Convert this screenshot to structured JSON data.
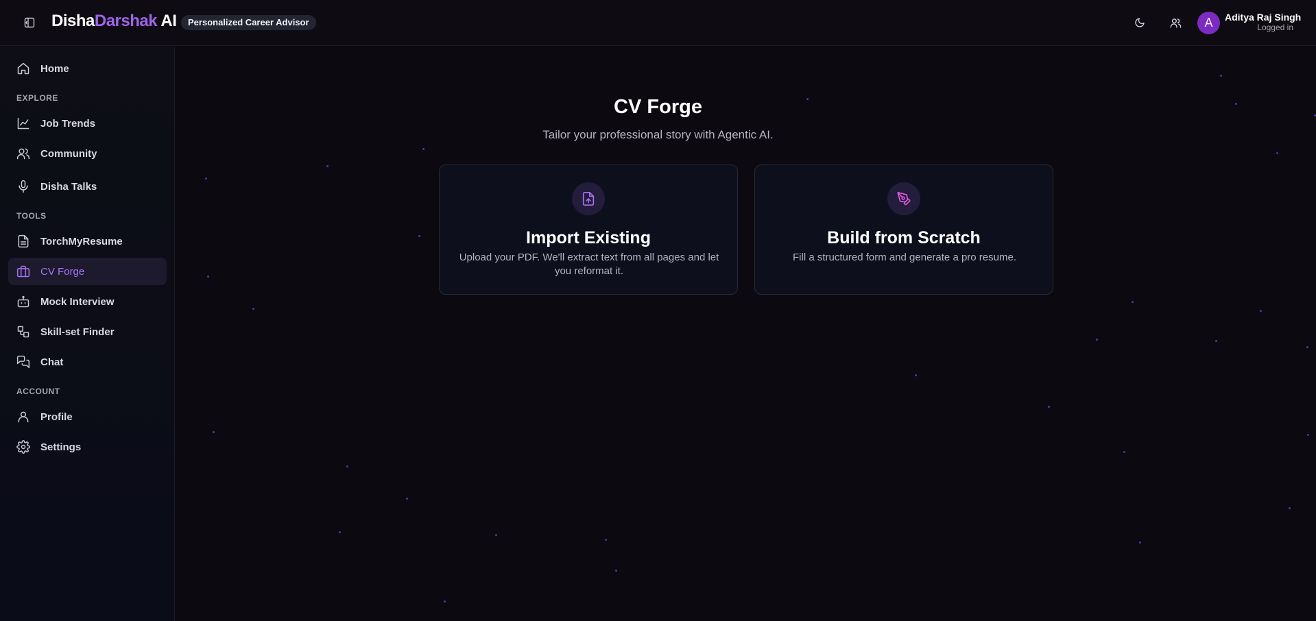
{
  "header": {
    "brand_part1": "Disha",
    "brand_part2": "Darshak",
    "brand_part3": " AI",
    "tagline": "Personalized Career Advisor",
    "user": {
      "avatar_initial": "A",
      "name": "Aditya Raj Singh",
      "status": "Logged in"
    },
    "icons": [
      "sidebar-toggle-icon",
      "moon-icon",
      "users-icon"
    ]
  },
  "sidebar": {
    "home": {
      "label": "Home",
      "icon": "home-icon"
    },
    "sections": {
      "explore": "EXPLORE",
      "tools": "TOOLS",
      "account": "ACCOUNT"
    },
    "explore_items": [
      {
        "label": "Job Trends",
        "icon": "chart-line-icon"
      },
      {
        "label": "Community",
        "icon": "users-icon"
      },
      {
        "label": "Disha Talks",
        "icon": "microphone-icon"
      }
    ],
    "tools_items": [
      {
        "label": "TorchMyResume",
        "icon": "document-icon"
      },
      {
        "label": "CV Forge",
        "icon": "briefcase-icon",
        "active": true
      },
      {
        "label": "Mock Interview",
        "icon": "robot-icon"
      },
      {
        "label": "Skill-set Finder",
        "icon": "shapes-icon"
      },
      {
        "label": "Chat",
        "icon": "chat-icon"
      }
    ],
    "account_items": [
      {
        "label": "Profile",
        "icon": "user-icon"
      },
      {
        "label": "Settings",
        "icon": "gear-icon"
      }
    ]
  },
  "main": {
    "title": "CV Forge",
    "subtitle": "Tailor your professional story with Agentic AI.",
    "cards": [
      {
        "title": "Import Existing",
        "description": "Upload your PDF. We'll extract text from all pages and let you reformat it.",
        "icon": "file-upload-icon"
      },
      {
        "title": "Build from Scratch",
        "description": "Fill a structured form and generate a pro resume.",
        "icon": "pen-tool-icon"
      }
    ]
  },
  "colors": {
    "accent": "#a063ea",
    "active_bg": "#1e1a2e",
    "background": "#0c0a10",
    "avatar": "#7b2bc0",
    "card_icon_pink": "#e05ae0"
  }
}
